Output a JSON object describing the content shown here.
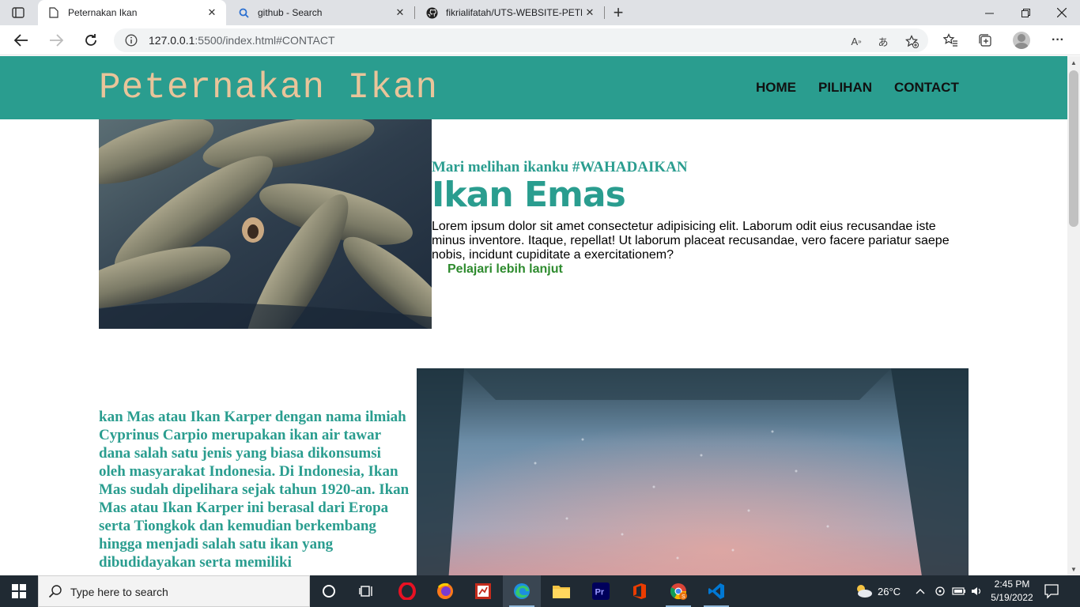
{
  "browser": {
    "tabs": [
      {
        "title": "Peternakan Ikan",
        "active": true
      },
      {
        "title": "github - Search",
        "active": false
      },
      {
        "title": "fikrialifatah/UTS-WEBSITE-PETER",
        "active": false
      }
    ],
    "url_host": "127.0.0.1",
    "url_rest": ":5500/index.html#CONTACT"
  },
  "site": {
    "logo": "Peternakan Ikan",
    "nav": [
      "HOME",
      "PILIHAN",
      "CONTACT"
    ],
    "hero": {
      "kicker": "Mari melihan ikanku #WAHADAIKAN",
      "title": "Ikan Emas",
      "body": "Lorem ipsum dolor sit amet consectetur adipisicing elit. Laborum odit eius recusandae iste minus inventore. Itaque, repellat! Ut laborum placeat recusandae, vero facere pariatur saepe nobis, incidunt cupiditate a exercitationem?",
      "link": "Pelajari lebih lanjut"
    },
    "story": "kan Mas atau Ikan Karper dengan nama ilmiah Cyprinus Carpio merupakan ikan air tawar dana salah satu jenis yang biasa dikonsumsi oleh masyarakat Indonesia. Di Indonesia, Ikan Mas sudah dipelihara sejak tahun 1920-an. Ikan Mas atau Ikan Karper ini berasal dari Eropa serta Tiongkok dan kemudian berkembang hingga menjadi salah satu ikan yang dibudidayakan serta memiliki"
  },
  "taskbar": {
    "search_placeholder": "Type here to search",
    "weather": "26°C",
    "time": "2:45 PM",
    "date": "5/19/2022"
  },
  "colors": {
    "header": "#2a9d8f",
    "logo": "#e9c49a",
    "link": "#2e8b2e"
  }
}
